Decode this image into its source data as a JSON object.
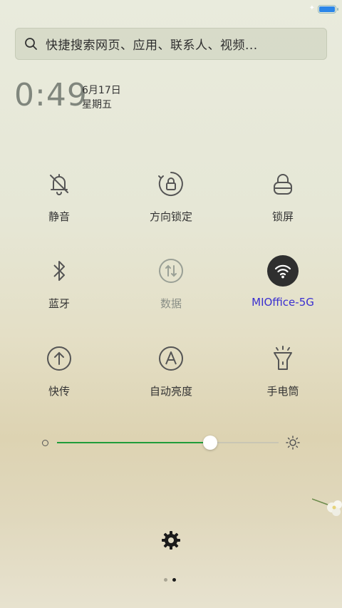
{
  "search": {
    "placeholder_text": "快捷搜索网页、应用、联系人、视频..."
  },
  "clock": {
    "hour": "0",
    "separator": ":",
    "minutes": "49",
    "date": "6月17日",
    "weekday": "星期五"
  },
  "status": {
    "battery_level": 1.0,
    "battery_color": "#2b85e8"
  },
  "toggles": [
    {
      "label": "静音",
      "icon": "bell-off-icon",
      "state": "off"
    },
    {
      "label": "方向锁定",
      "icon": "rotation-lock-icon",
      "state": "off"
    },
    {
      "label": "锁屏",
      "icon": "lock-icon",
      "state": "off"
    },
    {
      "label": "蓝牙",
      "icon": "bluetooth-icon",
      "state": "off"
    },
    {
      "label": "数据",
      "icon": "mobile-data-icon",
      "state": "disabled"
    },
    {
      "label": "MIOffice-5G",
      "icon": "wifi-icon",
      "state": "on"
    },
    {
      "label": "快传",
      "icon": "quick-transfer-icon",
      "state": "off"
    },
    {
      "label": "自动亮度",
      "icon": "auto-brightness-icon",
      "state": "off"
    },
    {
      "label": "手电筒",
      "icon": "flashlight-icon",
      "state": "off"
    }
  ],
  "brightness": {
    "level": 0.69,
    "accent": "#1f9d3a"
  },
  "page_indicator": {
    "current": 2,
    "total": 2
  }
}
